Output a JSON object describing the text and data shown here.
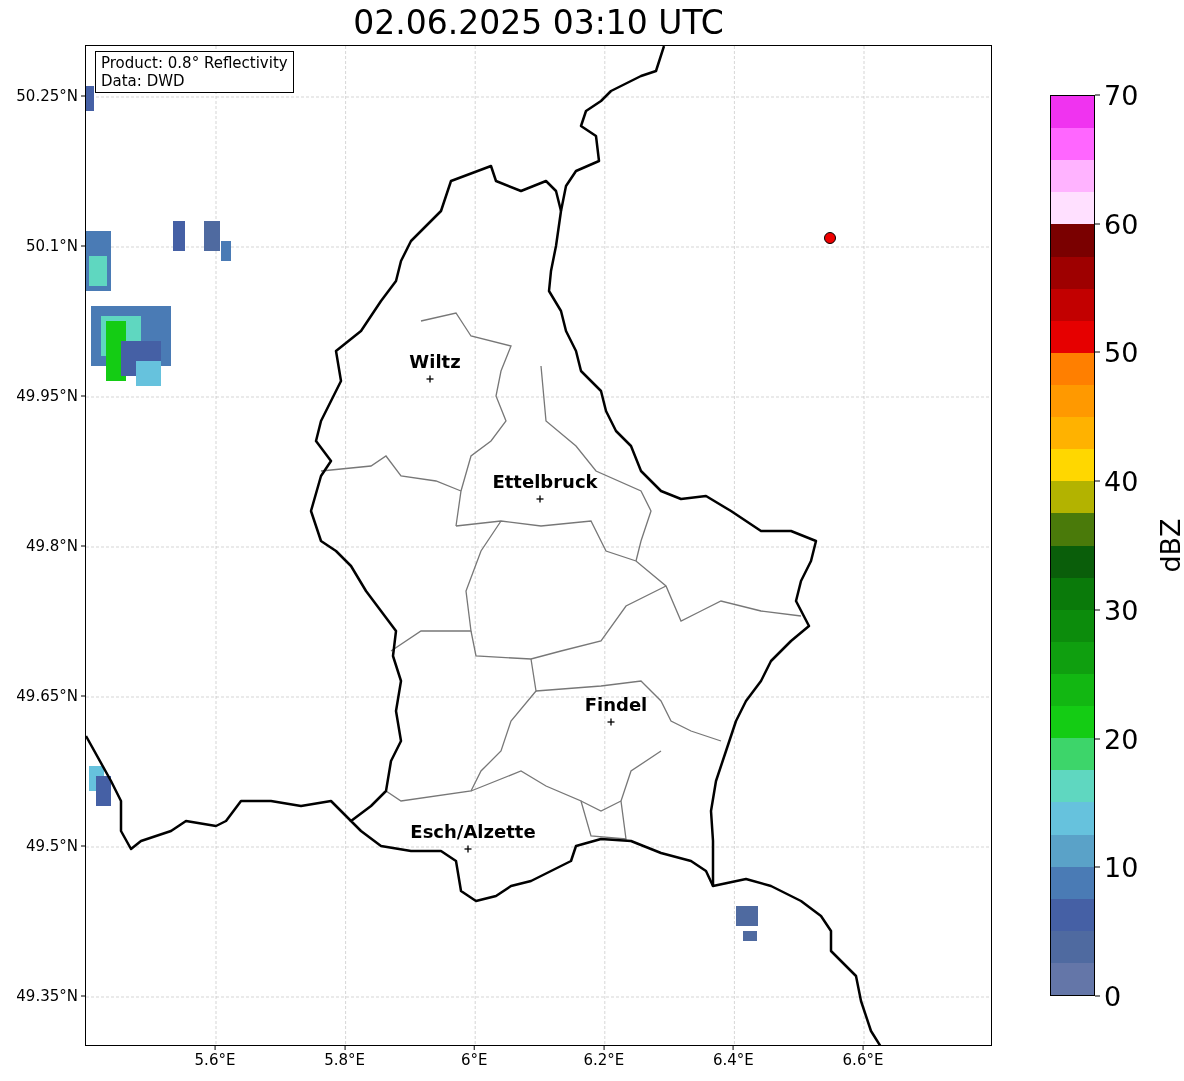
{
  "figure": {
    "title": "02.06.2025 03:10 UTC"
  },
  "legend": [
    "Product: 0.8° Reflectivity",
    "Data: DWD"
  ],
  "y_ticks": [
    "50.25°N",
    "50.1°N",
    "49.95°N",
    "49.8°N",
    "49.65°N",
    "49.5°N",
    "49.35°N"
  ],
  "x_ticks": [
    "5.6°E",
    "5.8°E",
    "6°E",
    "6.2°E",
    "6.4°E",
    "6.6°E"
  ],
  "places": [
    {
      "name": "Wiltz"
    },
    {
      "name": "Ettelbruck"
    },
    {
      "name": "Findel"
    },
    {
      "name": "Esch/Alzette"
    }
  ],
  "colorbar": {
    "label": "dBZ",
    "ticks": [
      "70",
      "60",
      "50",
      "40",
      "30",
      "20",
      "10",
      "0"
    ],
    "bands": [
      {
        "color": "#f033f0"
      },
      {
        "color": "#ff66ff"
      },
      {
        "color": "#ffb3ff"
      },
      {
        "color": "#ffe0ff"
      },
      {
        "color": "#7a0000"
      },
      {
        "color": "#9e0000"
      },
      {
        "color": "#c20000"
      },
      {
        "color": "#e60000"
      },
      {
        "color": "#ff7f00"
      },
      {
        "color": "#ff9900"
      },
      {
        "color": "#ffb200"
      },
      {
        "color": "#ffd700"
      },
      {
        "color": "#b3b300"
      },
      {
        "color": "#4a7a0a"
      },
      {
        "color": "#0a5e0a"
      },
      {
        "color": "#0a7a0a"
      },
      {
        "color": "#0c8c0c"
      },
      {
        "color": "#0f9f0f"
      },
      {
        "color": "#12b712"
      },
      {
        "color": "#14cc14"
      },
      {
        "color": "#3dd56a"
      },
      {
        "color": "#5fd7c0"
      },
      {
        "color": "#66c2dd"
      },
      {
        "color": "#5aa2c8"
      },
      {
        "color": "#4a7bb5"
      },
      {
        "color": "#4560a5"
      },
      {
        "color": "#4f6aa0"
      },
      {
        "color": "#6476a8"
      }
    ]
  }
}
